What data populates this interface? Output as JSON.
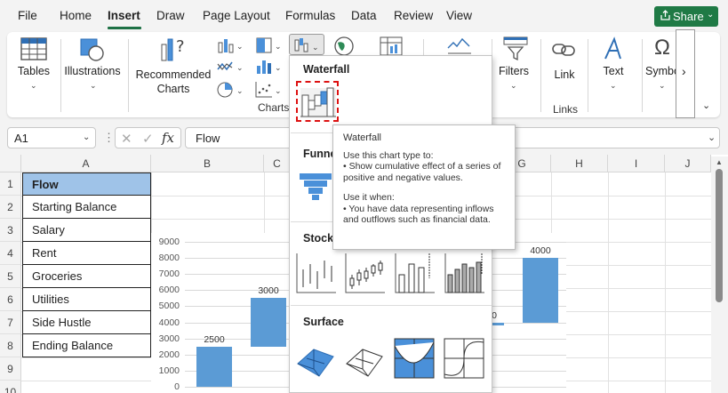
{
  "menu": {
    "items": [
      {
        "label": "File"
      },
      {
        "label": "Home"
      },
      {
        "label": "Insert"
      },
      {
        "label": "Draw"
      },
      {
        "label": "Page Layout"
      },
      {
        "label": "Formulas"
      },
      {
        "label": "Data"
      },
      {
        "label": "Review"
      },
      {
        "label": "View"
      }
    ],
    "active": "Insert",
    "share_label": "Share",
    "share_color": "#1f7a45"
  },
  "ribbon": {
    "tables_label": "Tables",
    "illustrations_label": "Illustrations",
    "recommended_charts_label1": "Recommended",
    "recommended_charts_label2": "Charts",
    "charts_group_label": "Charts",
    "filters_label": "Filters",
    "link_label": "Link",
    "links_group_label": "Links",
    "text_label": "Text",
    "symbols_label": "Symbo",
    "scroll_glyph": "›"
  },
  "formula_bar": {
    "name_box": "A1",
    "formula": "Flow"
  },
  "grid": {
    "columns": [
      "A",
      "B",
      "C",
      "D",
      "E",
      "F",
      "G",
      "H",
      "I",
      "J"
    ],
    "rows": [
      "1",
      "2",
      "3",
      "4",
      "5",
      "6",
      "7",
      "8",
      "9",
      "10"
    ],
    "column_a": [
      "Flow",
      "Starting Balance",
      "Salary",
      "Rent",
      "Groceries",
      "Utilities",
      "Side Hustle",
      "Ending Balance"
    ]
  },
  "chart_data": {
    "type": "bar",
    "yticks": [
      "9000",
      "8000",
      "7000",
      "6000",
      "5000",
      "4000",
      "3000",
      "2000",
      "1000",
      "0"
    ],
    "ylim": [
      0,
      9000
    ],
    "bars": [
      {
        "base": 0,
        "value": 2500,
        "label": "2500"
      },
      {
        "base": 2500,
        "value": 3000,
        "label": "3000"
      },
      {
        "base": 3800,
        "value": 200,
        "label": ""
      },
      {
        "base": 4000,
        "value": 4000,
        "label": "4000"
      }
    ],
    "partial_label": "0",
    "color": "#5b9bd5"
  },
  "dropdown": {
    "waterfall_label": "Waterfall",
    "funnel_label": "Funne",
    "stock_label": "Stock",
    "surface_label": "Surface"
  },
  "tooltip": {
    "title": "Waterfall",
    "desc": "Use this chart type to:\n• Show cumulative effect of a series of positive and negative values.",
    "when": "Use it when:\n• You have data representing inflows and outflows such as financial data."
  }
}
